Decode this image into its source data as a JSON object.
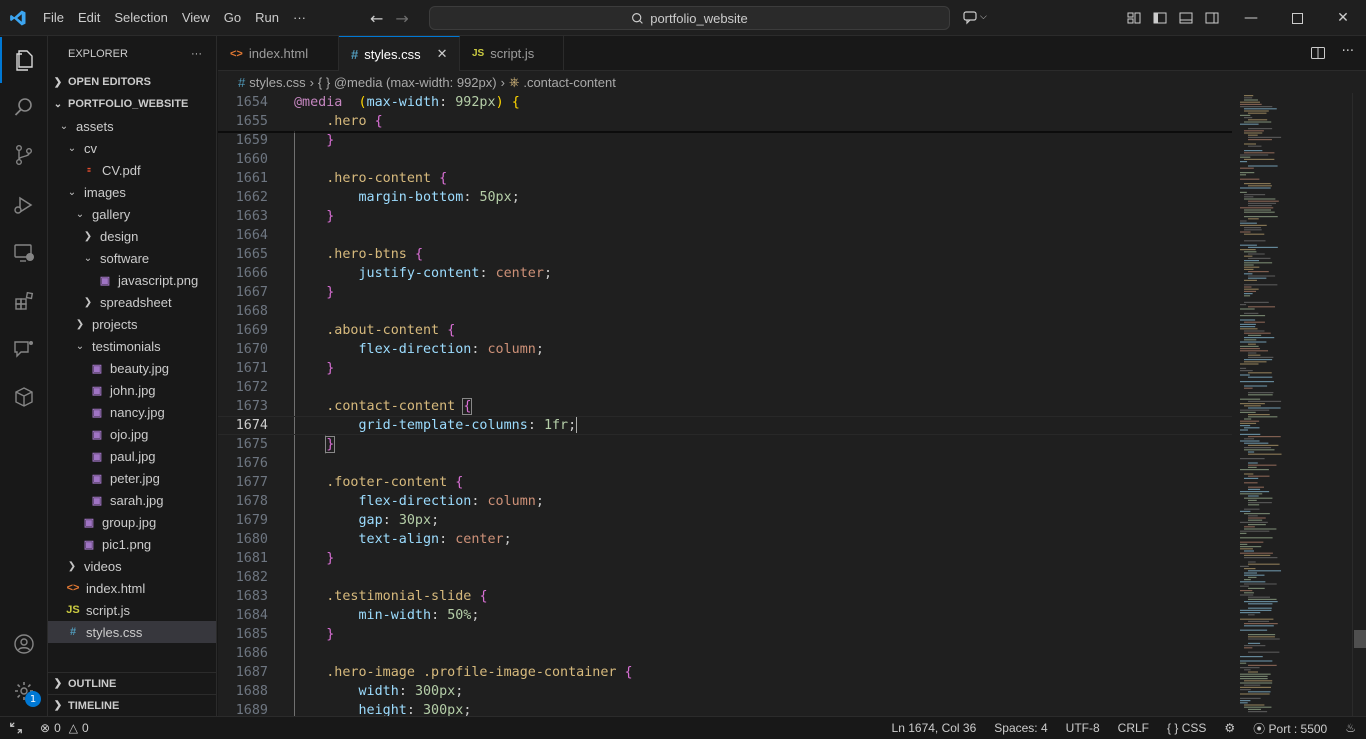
{
  "menu": [
    "File",
    "Edit",
    "Selection",
    "View",
    "Go",
    "Run",
    "···"
  ],
  "search": {
    "text": "portfolio_website"
  },
  "sidebar": {
    "title": "EXPLORER",
    "more": "···",
    "open_editors": "OPEN EDITORS",
    "project": "PORTFOLIO_WEBSITE",
    "tree": [
      {
        "label": "assets",
        "depth": 1,
        "kind": "folder-open"
      },
      {
        "label": "cv",
        "depth": 2,
        "kind": "folder-open"
      },
      {
        "label": "CV.pdf",
        "depth": 3,
        "kind": "pdf"
      },
      {
        "label": "images",
        "depth": 2,
        "kind": "folder-open"
      },
      {
        "label": "gallery",
        "depth": 3,
        "kind": "folder-open"
      },
      {
        "label": "design",
        "depth": 4,
        "kind": "folder"
      },
      {
        "label": "software",
        "depth": 4,
        "kind": "folder-open"
      },
      {
        "label": "javascript.png",
        "depth": 5,
        "kind": "image"
      },
      {
        "label": "spreadsheet",
        "depth": 4,
        "kind": "folder"
      },
      {
        "label": "projects",
        "depth": 3,
        "kind": "folder"
      },
      {
        "label": "testimonials",
        "depth": 3,
        "kind": "folder-open"
      },
      {
        "label": "beauty.jpg",
        "depth": 4,
        "kind": "image"
      },
      {
        "label": "john.jpg",
        "depth": 4,
        "kind": "image"
      },
      {
        "label": "nancy.jpg",
        "depth": 4,
        "kind": "image"
      },
      {
        "label": "ojo.jpg",
        "depth": 4,
        "kind": "image"
      },
      {
        "label": "paul.jpg",
        "depth": 4,
        "kind": "image"
      },
      {
        "label": "peter.jpg",
        "depth": 4,
        "kind": "image"
      },
      {
        "label": "sarah.jpg",
        "depth": 4,
        "kind": "image"
      },
      {
        "label": "group.jpg",
        "depth": 3,
        "kind": "image"
      },
      {
        "label": "pic1.png",
        "depth": 3,
        "kind": "image"
      },
      {
        "label": "videos",
        "depth": 2,
        "kind": "folder"
      },
      {
        "label": "index.html",
        "depth": 1,
        "kind": "html"
      },
      {
        "label": "script.js",
        "depth": 1,
        "kind": "js"
      },
      {
        "label": "styles.css",
        "depth": 1,
        "kind": "css",
        "selected": true
      }
    ],
    "outline": "OUTLINE",
    "timeline": "TIMELINE"
  },
  "tabs": [
    {
      "label": "index.html",
      "icon": "<>",
      "active": false
    },
    {
      "label": "styles.css",
      "icon": "#",
      "active": true
    },
    {
      "label": "script.js",
      "icon": "JS",
      "active": false
    }
  ],
  "breadcrumb": [
    "styles.css",
    "{ } @media (max-width: 992px)",
    ".contact-content"
  ],
  "editor": {
    "lines": [
      {
        "n": "1654",
        "code": [
          [
            "t-at",
            "@media"
          ],
          [
            "",
            "  "
          ],
          [
            "t-br1",
            "("
          ],
          [
            "t-prop",
            "max-width"
          ],
          [
            "",
            ": "
          ],
          [
            "t-num",
            "992px"
          ],
          [
            "t-br1",
            ")"
          ],
          [
            "",
            " "
          ],
          [
            "t-br1",
            "{"
          ]
        ]
      },
      {
        "n": "1655",
        "code": [
          [
            "",
            "    "
          ],
          [
            "t-sel",
            ".hero"
          ],
          [
            "",
            " "
          ],
          [
            "t-br2",
            "{"
          ]
        ]
      },
      {
        "n": "1659",
        "code": [
          [
            "",
            "    "
          ],
          [
            "t-br2",
            "}"
          ]
        ]
      },
      {
        "n": "1660",
        "code": []
      },
      {
        "n": "1661",
        "code": [
          [
            "",
            "    "
          ],
          [
            "t-sel",
            ".hero-content"
          ],
          [
            "",
            " "
          ],
          [
            "t-br2",
            "{"
          ]
        ]
      },
      {
        "n": "1662",
        "code": [
          [
            "",
            "        "
          ],
          [
            "t-prop",
            "margin-bottom"
          ],
          [
            "",
            ": "
          ],
          [
            "t-num",
            "50px"
          ],
          [
            "",
            ";"
          ]
        ]
      },
      {
        "n": "1663",
        "code": [
          [
            "",
            "    "
          ],
          [
            "t-br2",
            "}"
          ]
        ]
      },
      {
        "n": "1664",
        "code": []
      },
      {
        "n": "1665",
        "code": [
          [
            "",
            "    "
          ],
          [
            "t-sel",
            ".hero-btns"
          ],
          [
            "",
            " "
          ],
          [
            "t-br2",
            "{"
          ]
        ]
      },
      {
        "n": "1666",
        "code": [
          [
            "",
            "        "
          ],
          [
            "t-prop",
            "justify-content"
          ],
          [
            "",
            ": "
          ],
          [
            "t-val",
            "center"
          ],
          [
            "",
            ";"
          ]
        ]
      },
      {
        "n": "1667",
        "code": [
          [
            "",
            "    "
          ],
          [
            "t-br2",
            "}"
          ]
        ]
      },
      {
        "n": "1668",
        "code": []
      },
      {
        "n": "1669",
        "code": [
          [
            "",
            "    "
          ],
          [
            "t-sel",
            ".about-content"
          ],
          [
            "",
            " "
          ],
          [
            "t-br2",
            "{"
          ]
        ]
      },
      {
        "n": "1670",
        "code": [
          [
            "",
            "        "
          ],
          [
            "t-prop",
            "flex-direction"
          ],
          [
            "",
            ": "
          ],
          [
            "t-val",
            "column"
          ],
          [
            "",
            ";"
          ]
        ]
      },
      {
        "n": "1671",
        "code": [
          [
            "",
            "    "
          ],
          [
            "t-br2",
            "}"
          ]
        ]
      },
      {
        "n": "1672",
        "code": []
      },
      {
        "n": "1673",
        "code": [
          [
            "",
            "    "
          ],
          [
            "t-sel",
            ".contact-content"
          ],
          [
            "",
            " "
          ],
          [
            "t-br2 hl",
            "{"
          ]
        ]
      },
      {
        "n": "1674",
        "code": [
          [
            "",
            "        "
          ],
          [
            "t-prop",
            "grid-template-columns"
          ],
          [
            "",
            ": "
          ],
          [
            "t-num",
            "1fr"
          ],
          [
            "",
            ";"
          ],
          [
            "caret",
            ""
          ]
        ],
        "current": true
      },
      {
        "n": "1675",
        "code": [
          [
            "",
            "    "
          ],
          [
            "t-br2 hl",
            "}"
          ]
        ]
      },
      {
        "n": "1676",
        "code": []
      },
      {
        "n": "1677",
        "code": [
          [
            "",
            "    "
          ],
          [
            "t-sel",
            ".footer-content"
          ],
          [
            "",
            " "
          ],
          [
            "t-br2",
            "{"
          ]
        ]
      },
      {
        "n": "1678",
        "code": [
          [
            "",
            "        "
          ],
          [
            "t-prop",
            "flex-direction"
          ],
          [
            "",
            ": "
          ],
          [
            "t-val",
            "column"
          ],
          [
            "",
            ";"
          ]
        ]
      },
      {
        "n": "1679",
        "code": [
          [
            "",
            "        "
          ],
          [
            "t-prop",
            "gap"
          ],
          [
            "",
            ": "
          ],
          [
            "t-num",
            "30px"
          ],
          [
            "",
            ";"
          ]
        ]
      },
      {
        "n": "1680",
        "code": [
          [
            "",
            "        "
          ],
          [
            "t-prop",
            "text-align"
          ],
          [
            "",
            ": "
          ],
          [
            "t-val",
            "center"
          ],
          [
            "",
            ";"
          ]
        ]
      },
      {
        "n": "1681",
        "code": [
          [
            "",
            "    "
          ],
          [
            "t-br2",
            "}"
          ]
        ]
      },
      {
        "n": "1682",
        "code": []
      },
      {
        "n": "1683",
        "code": [
          [
            "",
            "    "
          ],
          [
            "t-sel",
            ".testimonial-slide"
          ],
          [
            "",
            " "
          ],
          [
            "t-br2",
            "{"
          ]
        ]
      },
      {
        "n": "1684",
        "code": [
          [
            "",
            "        "
          ],
          [
            "t-prop",
            "min-width"
          ],
          [
            "",
            ": "
          ],
          [
            "t-num",
            "50%"
          ],
          [
            "",
            ";"
          ]
        ]
      },
      {
        "n": "1685",
        "code": [
          [
            "",
            "    "
          ],
          [
            "t-br2",
            "}"
          ]
        ]
      },
      {
        "n": "1686",
        "code": []
      },
      {
        "n": "1687",
        "code": [
          [
            "",
            "    "
          ],
          [
            "t-sel",
            ".hero-image .profile-image-container"
          ],
          [
            "",
            " "
          ],
          [
            "t-br2",
            "{"
          ]
        ]
      },
      {
        "n": "1688",
        "code": [
          [
            "",
            "        "
          ],
          [
            "t-prop",
            "width"
          ],
          [
            "",
            ": "
          ],
          [
            "t-num",
            "300px"
          ],
          [
            "",
            ";"
          ]
        ]
      },
      {
        "n": "1689",
        "code": [
          [
            "",
            "        "
          ],
          [
            "t-prop",
            "height"
          ],
          [
            "",
            ": "
          ],
          [
            "t-num",
            "300px"
          ],
          [
            "",
            ";"
          ]
        ]
      }
    ]
  },
  "status": {
    "errors": "0",
    "warnings": "0",
    "position": "Ln 1674, Col 36",
    "spaces": "Spaces: 4",
    "encoding": "UTF-8",
    "eol": "CRLF",
    "language": "CSS",
    "port": "Port : 5500"
  },
  "accounts_badge": "1",
  "colors": {
    "accent": "#0078d4",
    "editor_bg": "#1f1f1f",
    "chrome_bg": "#181818"
  }
}
